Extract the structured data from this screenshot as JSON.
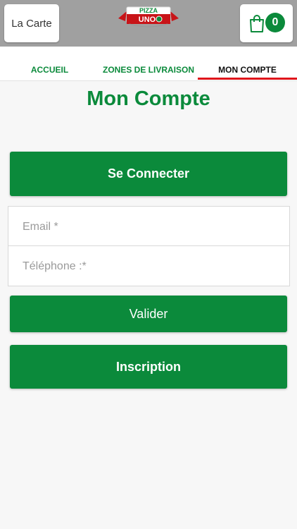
{
  "header": {
    "carte_label": "La Carte",
    "logo_top": "PIZZA",
    "logo_bottom": "UNO",
    "cart_count": "0"
  },
  "tabs": [
    {
      "label": "ACCUEIL"
    },
    {
      "label": "ZONES DE LIVRAISON"
    },
    {
      "label": "MON COMPTE"
    }
  ],
  "page": {
    "title": "Mon Compte",
    "connect_label": "Se Connecter",
    "email_placeholder": "Email *",
    "phone_placeholder": "Téléphone :*",
    "validate_label": "Valider",
    "register_label": "Inscription"
  },
  "colors": {
    "brand_green": "#0b8a3b",
    "accent_red": "#e0151b",
    "header_gray": "#a0a0a0"
  },
  "icons": {
    "cart": "shopping-bag-icon",
    "logo": "pizza-uno-logo"
  }
}
